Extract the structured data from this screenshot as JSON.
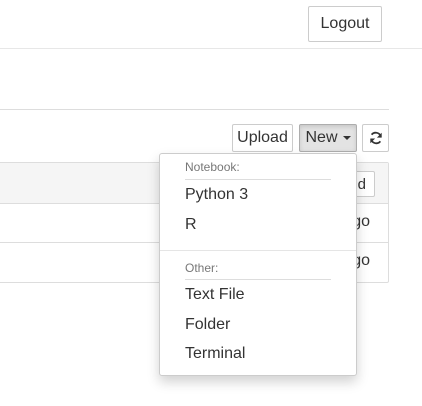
{
  "header": {
    "logout_label": "Logout"
  },
  "toolbar": {
    "upload_label": "Upload",
    "new_label": "New",
    "refresh_icon": "refresh-icon"
  },
  "list": {
    "sort_label": "ied",
    "rows": [
      {
        "time": "go"
      },
      {
        "time": "go"
      }
    ]
  },
  "new_menu": {
    "notebook_header": "Notebook:",
    "notebook_items": [
      "Python 3",
      "R"
    ],
    "other_header": "Other:",
    "other_items": [
      "Text File",
      "Folder",
      "Terminal"
    ]
  }
}
